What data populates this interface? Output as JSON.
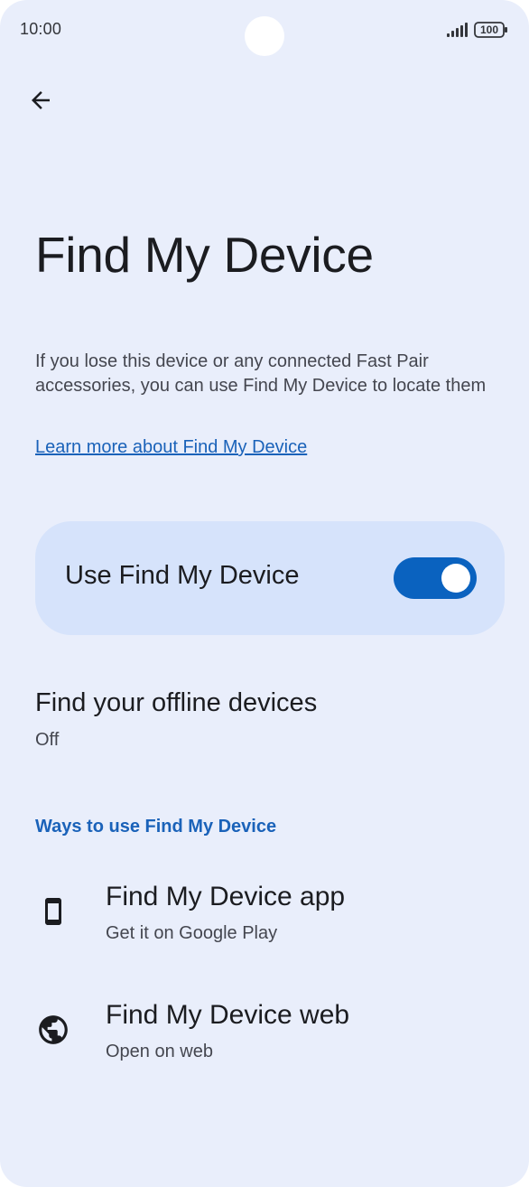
{
  "status_bar": {
    "time": "10:00",
    "battery_level": "100",
    "signal_icon": "signal-bars-icon",
    "battery_icon": "battery-icon"
  },
  "header": {
    "back_icon": "arrow-left-icon",
    "title": "Find My Device"
  },
  "intro": {
    "description": "If you lose this device or any connected Fast Pair accessories, you can use Find My Device to locate them",
    "learn_more_link": "Learn more about Find My Device"
  },
  "main_toggle": {
    "label": "Use Find My Device",
    "state": "on"
  },
  "offline_devices": {
    "title": "Find your offline devices",
    "status": "Off"
  },
  "ways_section": {
    "header": "Ways to use Find My Device",
    "items": [
      {
        "title": "Find My Device app",
        "subtitle": "Get it on Google Play",
        "icon": "smartphone-icon"
      },
      {
        "title": "Find My Device web",
        "subtitle": "Open on web",
        "icon": "globe-icon"
      }
    ]
  },
  "colors": {
    "background": "#e9eefb",
    "accent": "#1a62b9",
    "card": "#d6e3fb",
    "switch_on": "#0a62bf"
  }
}
